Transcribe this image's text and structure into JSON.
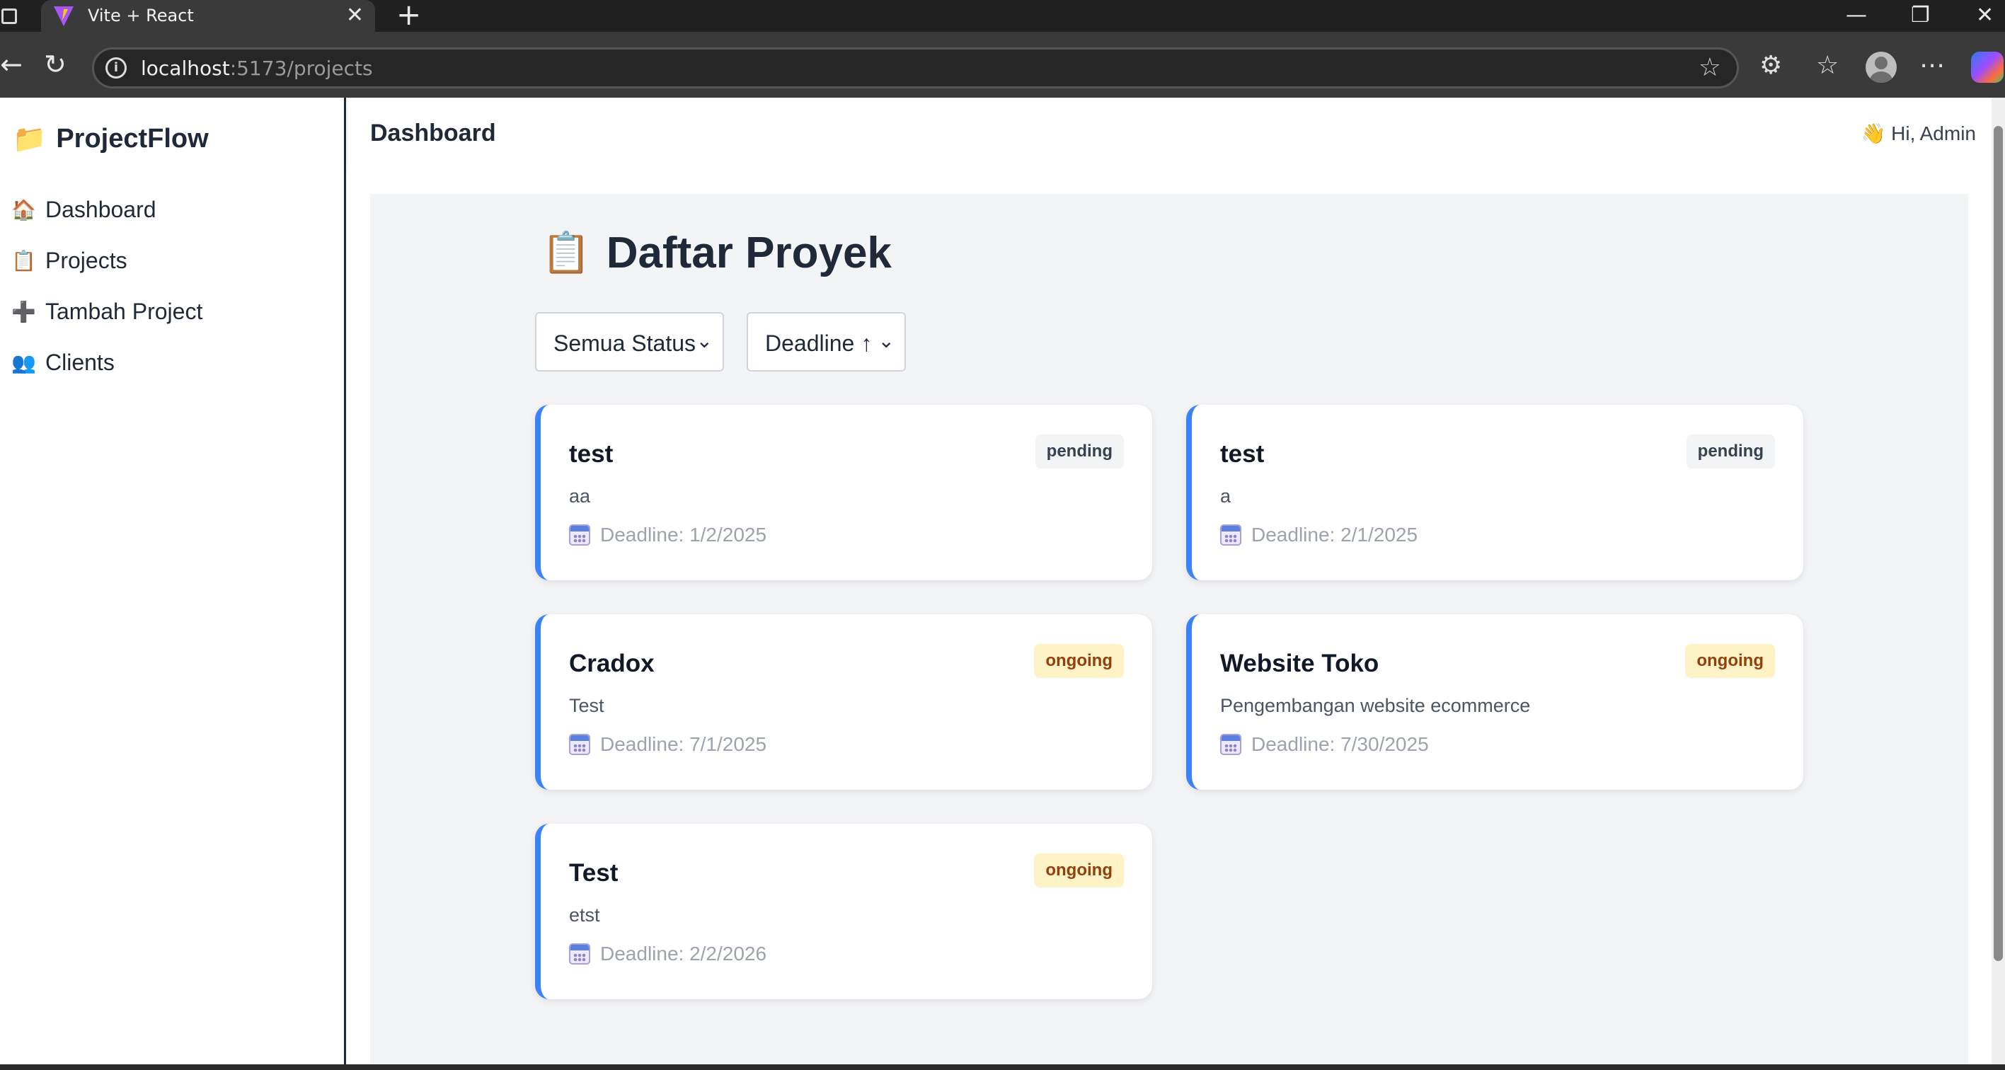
{
  "browser": {
    "tab_title": "Vite + React",
    "url_host": "localhost",
    "url_path": ":5173/projects",
    "tab_close": "✕",
    "new_tab": "+"
  },
  "app": {
    "brand": "ProjectFlow",
    "brand_icon": "📁",
    "sidebar": {
      "items": [
        {
          "label": "Dashboard",
          "icon": "🏠"
        },
        {
          "label": "Projects",
          "icon": "📋"
        },
        {
          "label": "Tambah Project",
          "icon": "➕"
        },
        {
          "label": "Clients",
          "icon": "👥"
        }
      ]
    },
    "header": {
      "title": "Dashboard",
      "greeting": "👋 Hi, Admin"
    }
  },
  "page": {
    "title_icon": "📋",
    "title": "Daftar Proyek",
    "filters": {
      "status_value": "Semua Status",
      "sort_value": "Deadline ↑"
    },
    "projects": [
      {
        "name": "test",
        "status": "pending",
        "description": "aa",
        "deadline": "Deadline: 1/2/2025"
      },
      {
        "name": "test",
        "status": "pending",
        "description": "a",
        "deadline": "Deadline: 2/1/2025"
      },
      {
        "name": "Cradox",
        "status": "ongoing",
        "description": "Test",
        "deadline": "Deadline: 7/1/2025"
      },
      {
        "name": "Website Toko",
        "status": "ongoing",
        "description": "Pengembangan website ecommerce",
        "deadline": "Deadline: 7/30/2025"
      },
      {
        "name": "Test",
        "status": "ongoing",
        "description": "etst",
        "deadline": "Deadline: 2/2/2026"
      }
    ]
  },
  "colors": {
    "accent": "#3b82f6",
    "pending_bg": "#f3f4f6",
    "ongoing_bg": "#fef3c7",
    "panel_bg": "#f3f4f6"
  }
}
